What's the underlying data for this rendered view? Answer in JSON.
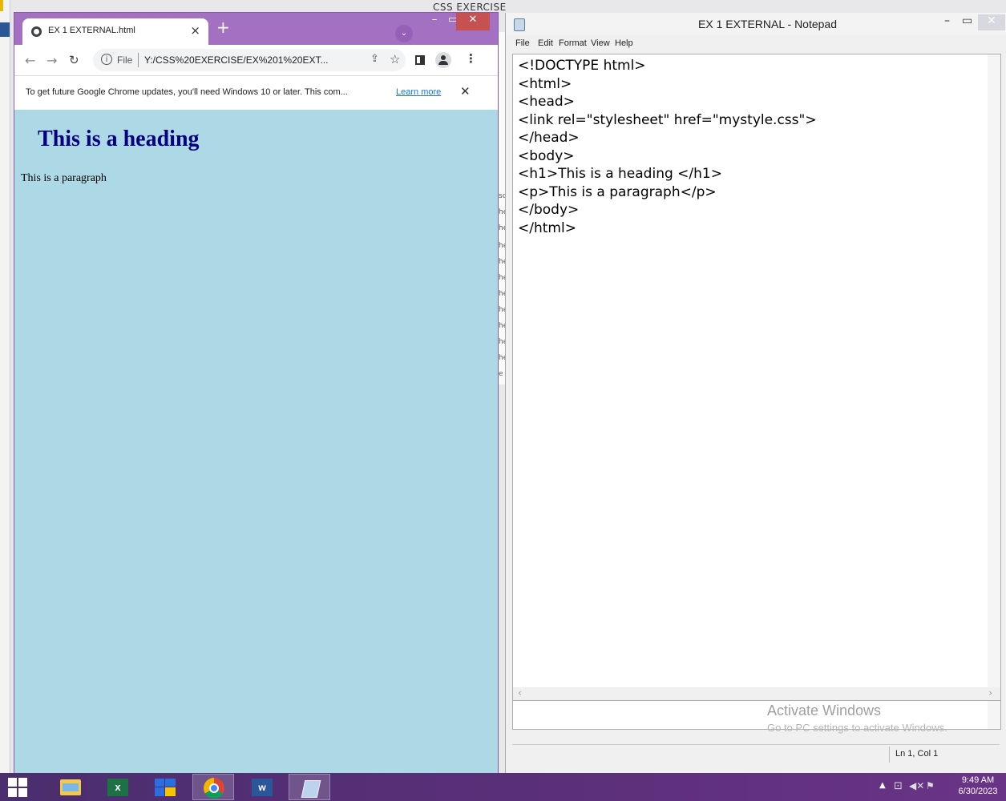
{
  "background": {
    "window_title": "CSS EXERCISE",
    "strip_chars": [
      "sc",
      "he",
      "he",
      "he",
      "he",
      "he",
      "he",
      "he",
      "he",
      "he",
      "he",
      "he",
      "e"
    ]
  },
  "chrome": {
    "tab_title": "EX 1 EXTERNAL.html",
    "tab_close": "×",
    "new_tab": "+",
    "tab_search": "⌄",
    "url_scheme": "File",
    "url": "Y:/CSS%20EXERCISE/EX%201%20EXT...",
    "infobar_message": "To get future Google Chrome updates, you'll need Windows 10 or later. This com...",
    "infobar_link": "Learn more",
    "infobar_close": "✕",
    "page": {
      "heading": "This is a heading",
      "paragraph": "This is a paragraph"
    },
    "colors": {
      "frame": "#a470c2",
      "page_background": "#add8e6",
      "heading_color": "#000080"
    }
  },
  "notepad": {
    "title": "EX 1 EXTERNAL - Notepad",
    "menu": [
      "File",
      "Edit",
      "Format",
      "View",
      "Help"
    ],
    "content": "<!DOCTYPE html>\n<html>\n<head>\n<link rel=\"stylesheet\" href=\"mystyle.css\">\n</head>\n<body>\n<h1>This is a heading </h1>\n<p>This is a paragraph</p>\n</body>\n</html>",
    "status_position": "Ln 1, Col 1"
  },
  "watermark": {
    "line1": "Activate Windows",
    "line2": "Go to PC settings to activate Windows."
  },
  "taskbar": {
    "apps": [
      "start-icon",
      "file-explorer-icon",
      "excel-icon",
      "powerpoint-icon",
      "chrome-icon",
      "word-icon",
      "notepad-icon"
    ],
    "time": "9:49 AM",
    "date": "6/30/2023"
  }
}
